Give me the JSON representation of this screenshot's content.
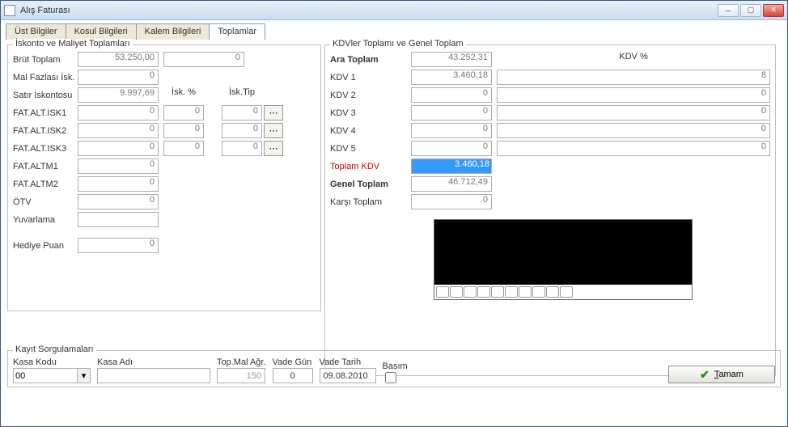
{
  "window": {
    "title": "Alış Faturası"
  },
  "tabs": [
    "Üst Bilgiler",
    "Kosul Bilgileri",
    "Kalem Bilgileri",
    "Toplamlar"
  ],
  "active_tab": 3,
  "left": {
    "legend": "İskonto ve Maliyet Toplamları",
    "hdr_iskpct": "İsk. %",
    "hdr_isktip": "İsk.Tip",
    "rows": {
      "brut": {
        "label": "Brüt Toplam",
        "v1": "53.250,00",
        "v2": "0"
      },
      "malfaz": {
        "label": "Mal Fazlası İsk.",
        "v1": "0"
      },
      "satirisk": {
        "label": "Satır İskontosu",
        "v1": "9.997,69"
      },
      "fai1": {
        "label": "FAT.ALT.ISK1",
        "v1": "0",
        "p": "0",
        "t": "0"
      },
      "fai2": {
        "label": "FAT.ALT.ISK2",
        "v1": "0",
        "p": "0",
        "t": "0"
      },
      "fai3": {
        "label": "FAT.ALT.ISK3",
        "v1": "0",
        "p": "0",
        "t": "0"
      },
      "fam1": {
        "label": "FAT.ALTM1",
        "v1": "0"
      },
      "fam2": {
        "label": "FAT.ALTM2",
        "v1": "0"
      },
      "otv": {
        "label": "ÖTV",
        "v1": "0"
      },
      "yuv": {
        "label": "Yuvarlama",
        "v1": ""
      },
      "hediye": {
        "label": "Hediye Puan",
        "v1": "0"
      }
    }
  },
  "right": {
    "legend": "KDVler Toplamı ve Genel Toplam",
    "hdr_kdvpct": "KDV %",
    "rows": {
      "ara": {
        "label": "Ara Toplam",
        "v": "43.252,31",
        "kdv": ""
      },
      "kdv1": {
        "label": "KDV 1",
        "v": "3.460,18",
        "kdv": "8"
      },
      "kdv2": {
        "label": "KDV 2",
        "v": "0",
        "kdv": "0"
      },
      "kdv3": {
        "label": "KDV 3",
        "v": "0",
        "kdv": "0"
      },
      "kdv4": {
        "label": "KDV 4",
        "v": "0",
        "kdv": "0"
      },
      "kdv5": {
        "label": "KDV 5",
        "v": "0",
        "kdv": "0"
      },
      "topkdv": {
        "label": "Toplam KDV",
        "v": "3.460,18"
      },
      "genel": {
        "label": "Genel Toplam",
        "v": "46.712,49"
      },
      "karsi": {
        "label": "Karşı Toplam",
        "v": "0"
      }
    }
  },
  "bottom": {
    "legend": "Kayıt Sorgulamaları",
    "kasakodu_lbl": "Kasa Kodu",
    "kasakodu": "00",
    "kasaadi_lbl": "Kasa Adı",
    "kasaadi": "",
    "topmal_lbl": "Top.Mal Ağr.",
    "topmal": "150",
    "vadegun_lbl": "Vade Gün",
    "vadegun": "0",
    "vadetarih_lbl": "Vade Tarih",
    "vadetarih": "09.08.2010",
    "basim_lbl": "Basım",
    "ok": "Tamam"
  }
}
